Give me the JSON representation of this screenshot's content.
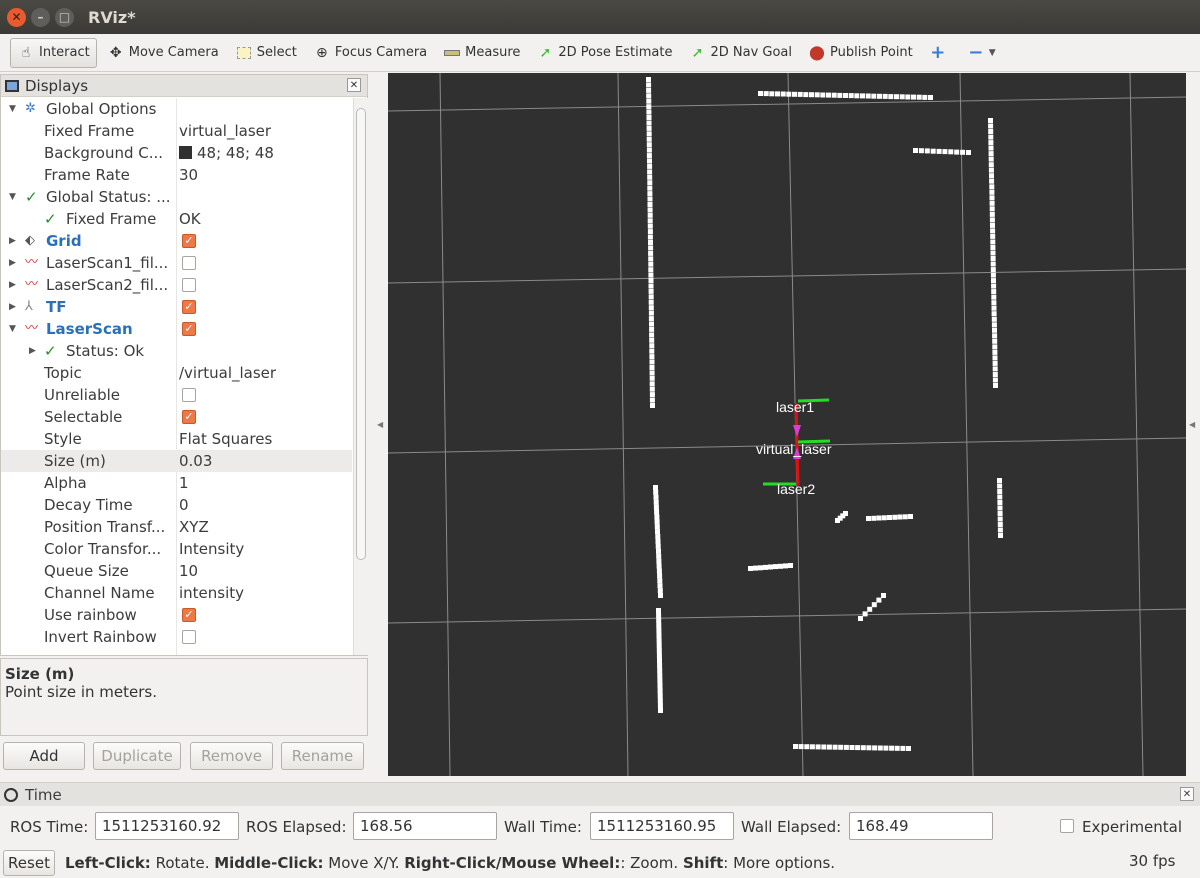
{
  "window": {
    "title": "RViz*"
  },
  "toolbar": {
    "interact": "Interact",
    "move_camera": "Move Camera",
    "select": "Select",
    "focus_camera": "Focus Camera",
    "measure": "Measure",
    "pose_estimate": "2D Pose Estimate",
    "nav_goal": "2D Nav Goal",
    "publish_point": "Publish Point"
  },
  "displays": {
    "title": "Displays",
    "rows": {
      "global_options": "Global Options",
      "fixed_frame": "Fixed Frame",
      "fixed_frame_value": "virtual_laser",
      "background": "Background C...",
      "background_value": "48; 48; 48",
      "background_color": "#303030",
      "frame_rate": "Frame Rate",
      "frame_rate_value": "30",
      "global_status": "Global Status: ...",
      "gs_fixed_frame": "Fixed Frame",
      "gs_fixed_frame_value": "OK",
      "grid": "Grid",
      "laserscan1": "LaserScan1_fil...",
      "laserscan2": "LaserScan2_fil...",
      "tf": "TF",
      "laserscan": "LaserScan",
      "status": "Status: Ok",
      "topic": "Topic",
      "topic_value": "/virtual_laser",
      "unreliable": "Unreliable",
      "selectable": "Selectable",
      "style": "Style",
      "style_value": "Flat Squares",
      "size": "Size (m)",
      "size_value": "0.03",
      "alpha": "Alpha",
      "alpha_value": "1",
      "decay": "Decay Time",
      "decay_value": "0",
      "position_transform": "Position Transf...",
      "position_transform_value": "XYZ",
      "color_transform": "Color Transfor...",
      "color_transform_value": "Intensity",
      "queue_size": "Queue Size",
      "queue_size_value": "10",
      "channel_name": "Channel Name",
      "channel_name_value": "intensity",
      "use_rainbow": "Use rainbow",
      "invert_rainbow": "Invert Rainbow"
    },
    "checks": {
      "grid": true,
      "laserscan1": false,
      "laserscan2": false,
      "tf": true,
      "laserscan": true,
      "unreliable": false,
      "selectable": true,
      "use_rainbow": true,
      "invert_rainbow": false
    }
  },
  "help": {
    "title": "Size (m)",
    "text": "Point size in meters."
  },
  "buttons": {
    "add": "Add",
    "duplicate": "Duplicate",
    "remove": "Remove",
    "rename": "Rename"
  },
  "viewport": {
    "frames": {
      "laser1": "laser1",
      "virtual_laser": "virtual_laser",
      "laser2": "laser2"
    }
  },
  "time": {
    "title": "Time",
    "ros_time_label": "ROS Time:",
    "ros_time": "1511253160.92",
    "ros_elapsed_label": "ROS Elapsed:",
    "ros_elapsed": "168.56",
    "wall_time_label": "Wall Time:",
    "wall_time": "1511253160.95",
    "wall_elapsed_label": "Wall Elapsed:",
    "wall_elapsed": "168.49",
    "experimental": "Experimental"
  },
  "status": {
    "reset": "Reset",
    "h1": "Left-Click:",
    "t1": " Rotate. ",
    "h2": "Middle-Click:",
    "t2": " Move X/Y. ",
    "h3": "Right-Click/Mouse Wheel:",
    "t3": ": Zoom. ",
    "h4": "Shift",
    "t4": ": More options.",
    "fps": "30 fps"
  },
  "colors": {
    "accent": "#f07746",
    "blue_label": "#2b6fb8"
  }
}
